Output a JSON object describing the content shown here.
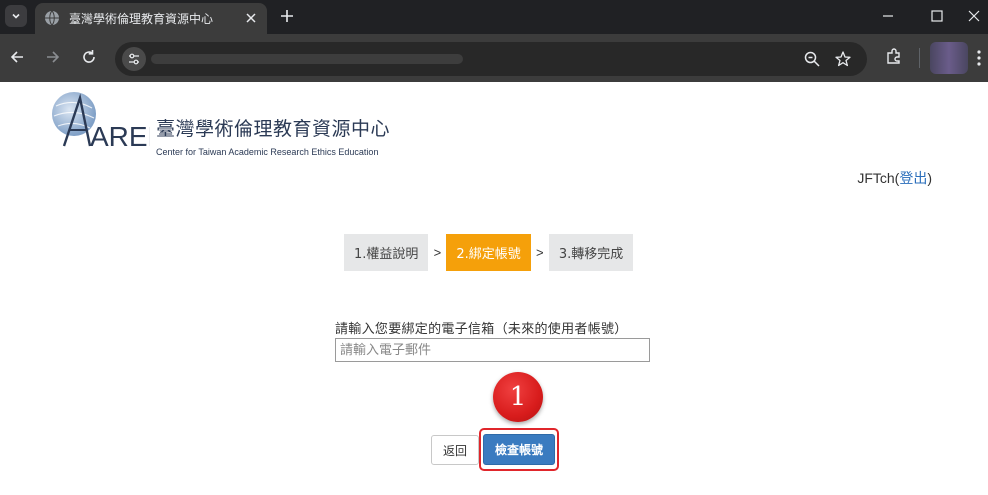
{
  "browser": {
    "tab_title": "臺灣學術倫理教育資源中心"
  },
  "site": {
    "logo_cn": "臺灣學術倫理教育資源中心",
    "logo_en": "Center for Taiwan Academic Research Ethics Education",
    "logo_mark_text": "AREE"
  },
  "user": {
    "name": "JFTch",
    "paren_open": "(",
    "logout_label": "登出",
    "paren_close": ")"
  },
  "steps": [
    {
      "label": "1.權益說明",
      "active": false
    },
    {
      "label": "2.綁定帳號",
      "active": true
    },
    {
      "label": "3.轉移完成",
      "active": false
    }
  ],
  "step_separator": ">",
  "form": {
    "email_label": "請輸入您要綁定的電子信箱（未來的使用者帳號）",
    "email_placeholder": "請輸入電子郵件",
    "email_value": ""
  },
  "annotation": {
    "badge_number": "1",
    "badge_color": "#d81c1c"
  },
  "buttons": {
    "back_label": "返回",
    "check_label": "檢查帳號"
  },
  "colors": {
    "active_step": "#f5a00a",
    "primary_button": "#3a7bc0",
    "link": "#2a6ebb"
  }
}
